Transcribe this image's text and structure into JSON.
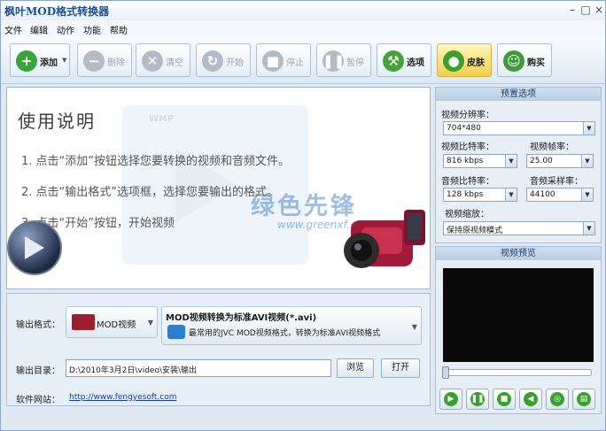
{
  "app": {
    "title": "枫叶MOD格式转换器"
  },
  "window_controls": {
    "minimize": "–",
    "maximize": "□",
    "close": "×"
  },
  "menu": [
    "文件",
    "编辑",
    "动作",
    "功能",
    "帮助"
  ],
  "toolbar": {
    "add": "添加",
    "delete": "删除",
    "clear": "清空",
    "start": "开始",
    "stop": "停止",
    "pause": "暂停",
    "options": "选项",
    "skin": "皮肤",
    "buy": "购买"
  },
  "help": {
    "title": "使用说明",
    "steps": [
      "1. 点击“添加”按钮选择您要转换的视频和音频文件。",
      "2. 点击“输出格式”选项框，选择您要输出的格式。",
      "3. 点击“开始”按钮，开始视频"
    ],
    "watermark_label": "WMP",
    "site_watermark": "绿色先锋",
    "site_watermark_sub": "www.greenxf.com"
  },
  "output": {
    "format_label": "输出格式：",
    "format_value": "MOD视频",
    "format_title": "MOD视频转换为标准AVI视频(*.avi)",
    "format_desc": "最常用的JVC MOD视频格式，转换为标准AVI视频格式",
    "dir_label": "输出目录：",
    "dir_value": "D:\\2010年3月2日\\video\\安装\\输出",
    "browse": "浏览",
    "open": "打开",
    "site_label": "软件网站：",
    "site_value": "http://www.fengyesoft.com"
  },
  "preset": {
    "title": "预置选项",
    "resolution_label": "视频分辨率：",
    "resolution": "704*480",
    "vbitrate_label": "视频比特率：",
    "vbitrate": "816 kbps",
    "framerate_label": "视频帧率：",
    "framerate": "25.00",
    "abitrate_label": "音频比特率：",
    "abitrate": "128 kbps",
    "samplerate_label": "音频采样率：",
    "samplerate": "44100",
    "zoom_label": "视频缩放：",
    "zoom": "保持原视频模式"
  },
  "preview": {
    "title": "视频预览",
    "seek_fraction": 0.0,
    "buttons": [
      "play-icon",
      "pause-icon",
      "stop-icon",
      "previous-icon",
      "screenshot-icon",
      "folder-icon"
    ]
  },
  "colors": {
    "accent": "#1d4f8a",
    "window_bg": "#dfe9f3",
    "green": "#37a12c",
    "skin_gold": "#f2cf4a"
  }
}
